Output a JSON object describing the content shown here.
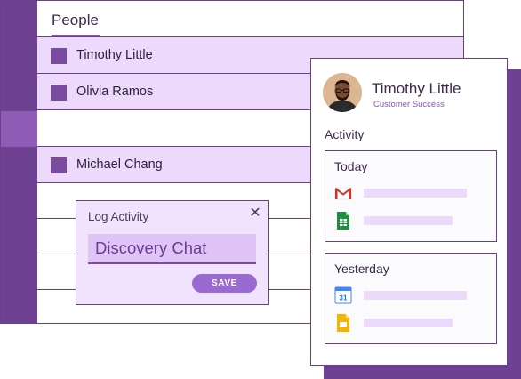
{
  "people": {
    "title": "People",
    "rows": [
      {
        "name": "Timothy Little",
        "filled": true
      },
      {
        "name": "Olivia Ramos",
        "filled": true
      },
      {
        "name": "",
        "filled": false
      },
      {
        "name": "Michael Chang",
        "filled": true
      },
      {
        "name": "",
        "filled": false
      },
      {
        "name": "",
        "filled": false
      },
      {
        "name": "",
        "filled": false
      },
      {
        "name": "",
        "filled": false
      }
    ]
  },
  "dialog": {
    "title": "Log Activity",
    "close_icon": "close-icon",
    "input_value": "Discovery Chat",
    "save_label": "SAVE"
  },
  "profile": {
    "name": "Timothy Little",
    "role": "Customer Success",
    "activity_label": "Activity",
    "groups": [
      {
        "label": "Today",
        "items": [
          {
            "icon": "gmail-icon"
          },
          {
            "icon": "sheets-icon"
          }
        ]
      },
      {
        "label": "Yesterday",
        "items": [
          {
            "icon": "calendar-icon",
            "calendar_day": "31"
          },
          {
            "icon": "slides-icon"
          }
        ]
      }
    ]
  },
  "colors": {
    "accent": "#6e4192",
    "row_fill": "#ecd9fb",
    "save_button": "#9a6ad0"
  }
}
